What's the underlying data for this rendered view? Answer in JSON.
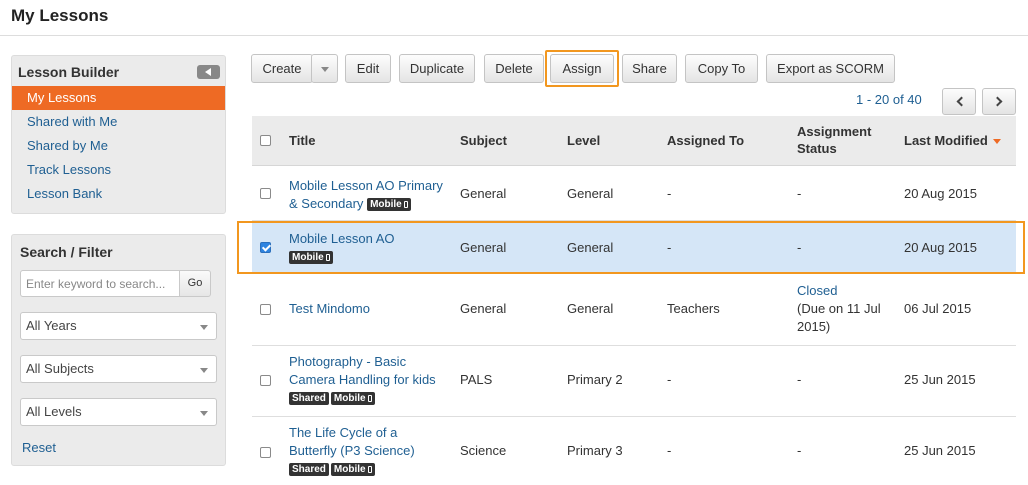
{
  "page": {
    "title": "My Lessons"
  },
  "sidebar": {
    "lesson_builder": {
      "title": "Lesson Builder",
      "items": [
        {
          "label": "My Lessons",
          "active": true
        },
        {
          "label": "Shared with Me"
        },
        {
          "label": "Shared by Me"
        },
        {
          "label": "Track Lessons"
        },
        {
          "label": "Lesson Bank"
        }
      ]
    },
    "search_filter": {
      "title": "Search / Filter",
      "search_placeholder": "Enter keyword to search...",
      "go_label": "Go",
      "years_value": "All Years",
      "subjects_value": "All Subjects",
      "levels_value": "All Levels",
      "reset_label": "Reset"
    }
  },
  "toolbar": {
    "create": "Create",
    "edit": "Edit",
    "duplicate": "Duplicate",
    "delete": "Delete",
    "assign": "Assign",
    "share": "Share",
    "copy_to": "Copy To",
    "export": "Export as SCORM"
  },
  "pagination": {
    "info": "1 - 20 of 40"
  },
  "table": {
    "columns": {
      "title": "Title",
      "subject": "Subject",
      "level": "Level",
      "assigned_to": "Assigned To",
      "assignment_status_1": "Assignment",
      "assignment_status_2": "Status",
      "last_modified": "Last Modified"
    },
    "badges": {
      "mobile": "Mobile",
      "shared": "Shared"
    },
    "rows": [
      {
        "title_1": "Mobile Lesson AO Primary",
        "title_2": "& Secondary",
        "subject": "General",
        "level": "General",
        "assigned_to": "-",
        "status": "-",
        "modified": "20 Aug 2015",
        "checked": false
      },
      {
        "title_1": "Mobile Lesson AO",
        "subject": "General",
        "level": "General",
        "assigned_to": "-",
        "status": "-",
        "modified": "20 Aug 2015",
        "checked": true
      },
      {
        "title_1": "Test Mindomo",
        "subject": "General",
        "level": "General",
        "assigned_to": "Teachers",
        "status_link": "Closed",
        "status_2": "(Due on 11 Jul",
        "status_3": "2015)",
        "modified": "06 Jul 2015",
        "checked": false
      },
      {
        "title_1": "Photography - Basic",
        "title_2": "Camera Handling for kids",
        "subject": "PALS",
        "level": "Primary 2",
        "assigned_to": "-",
        "status": "-",
        "modified": "25 Jun 2015",
        "checked": false
      },
      {
        "title_1": "The Life Cycle of a",
        "title_2": "Butterfly (P3 Science)",
        "subject": "Science",
        "level": "Primary 3",
        "assigned_to": "-",
        "status": "-",
        "modified": "25 Jun 2015",
        "checked": false
      }
    ]
  }
}
